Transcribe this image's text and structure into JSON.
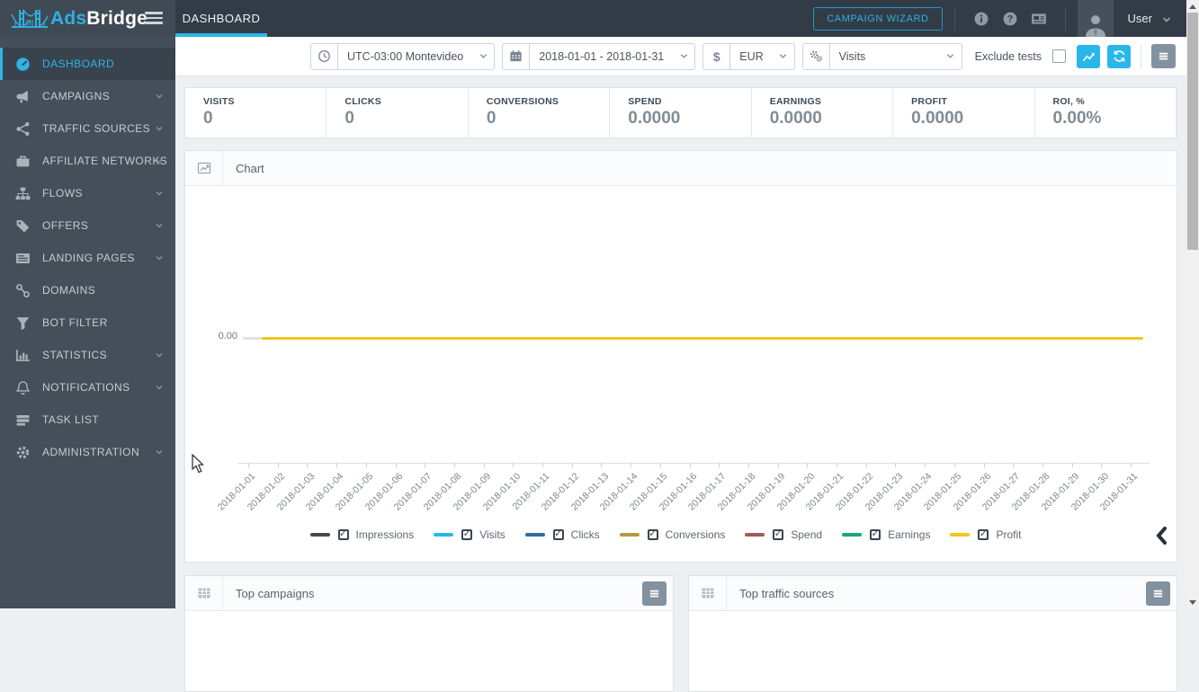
{
  "brand": {
    "name_a": "Ads",
    "name_b": "Bridge"
  },
  "topbar": {
    "active_tab": "DASHBOARD",
    "campaign_wizard_label": "CAMPAIGN WIZARD",
    "icons": [
      "info-icon",
      "help-icon",
      "news-icon"
    ],
    "user_label": "User"
  },
  "filter_bar": {
    "timezone_icon": "clock-icon",
    "timezone_value": "UTC-03:00 Montevideo",
    "date_icon": "calendar-icon",
    "date_range_value": "2018-01-01 - 2018-01-31",
    "currency_symbol": "$",
    "currency_value": "EUR",
    "metric_icon": "gears-icon",
    "metric_value": "Visits",
    "exclude_tests_label": "Exclude tests",
    "exclude_tests_checked": false,
    "buttons": [
      "trend-chart-button",
      "refresh-button",
      "menu-button"
    ]
  },
  "sidebar": {
    "items": [
      {
        "label": "DASHBOARD",
        "icon": "gauge-icon",
        "active": true,
        "expandable": false
      },
      {
        "label": "CAMPAIGNS",
        "icon": "megaphone-icon",
        "active": false,
        "expandable": true
      },
      {
        "label": "TRAFFIC SOURCES",
        "icon": "share-icon",
        "active": false,
        "expandable": true
      },
      {
        "label": "AFFILIATE NETWORKS",
        "icon": "briefcase-icon",
        "active": false,
        "expandable": true
      },
      {
        "label": "FLOWS",
        "icon": "sitemap-icon",
        "active": false,
        "expandable": true
      },
      {
        "label": "OFFERS",
        "icon": "tag-icon",
        "active": false,
        "expandable": true
      },
      {
        "label": "LANDING PAGES",
        "icon": "pages-icon",
        "active": false,
        "expandable": true
      },
      {
        "label": "DOMAINS",
        "icon": "link-icon",
        "active": false,
        "expandable": false
      },
      {
        "label": "BOT FILTER",
        "icon": "filter-icon",
        "active": false,
        "expandable": false
      },
      {
        "label": "STATISTICS",
        "icon": "bar-chart-icon",
        "active": false,
        "expandable": true
      },
      {
        "label": "NOTIFICATIONS",
        "icon": "bell-icon",
        "active": false,
        "expandable": true
      },
      {
        "label": "TASK LIST",
        "icon": "task-list-icon",
        "active": false,
        "expandable": false
      },
      {
        "label": "ADMINISTRATION",
        "icon": "gear-icon",
        "active": false,
        "expandable": true
      }
    ]
  },
  "stats": [
    {
      "label": "VISITS",
      "value": "0"
    },
    {
      "label": "CLICKS",
      "value": "0"
    },
    {
      "label": "CONVERSIONS",
      "value": "0"
    },
    {
      "label": "SPEND",
      "value": "0.0000"
    },
    {
      "label": "EARNINGS",
      "value": "0.0000"
    },
    {
      "label": "PROFIT",
      "value": "0.0000"
    },
    {
      "label": "ROI, %",
      "value": "0.00%"
    }
  ],
  "chart_panel": {
    "title": "Chart",
    "y_axis_label": "0.00"
  },
  "chart_data": {
    "type": "line",
    "title": "Chart",
    "x": [
      "2018-01-01",
      "2018-01-02",
      "2018-01-03",
      "2018-01-04",
      "2018-01-05",
      "2018-01-06",
      "2018-01-07",
      "2018-01-08",
      "2018-01-09",
      "2018-01-10",
      "2018-01-11",
      "2018-01-12",
      "2018-01-13",
      "2018-01-14",
      "2018-01-15",
      "2018-01-16",
      "2018-01-17",
      "2018-01-18",
      "2018-01-19",
      "2018-01-20",
      "2018-01-21",
      "2018-01-22",
      "2018-01-23",
      "2018-01-24",
      "2018-01-25",
      "2018-01-26",
      "2018-01-27",
      "2018-01-28",
      "2018-01-29",
      "2018-01-30",
      "2018-01-31"
    ],
    "y_ticks": [
      "0.00"
    ],
    "ylim": [
      0,
      0
    ],
    "grid": false,
    "legend_position": "bottom",
    "series": [
      {
        "name": "Impressions",
        "color": "#3e4a54",
        "checked": true,
        "values": [
          0,
          0,
          0,
          0,
          0,
          0,
          0,
          0,
          0,
          0,
          0,
          0,
          0,
          0,
          0,
          0,
          0,
          0,
          0,
          0,
          0,
          0,
          0,
          0,
          0,
          0,
          0,
          0,
          0,
          0,
          0
        ]
      },
      {
        "name": "Visits",
        "color": "#29b6e8",
        "checked": true,
        "values": [
          0,
          0,
          0,
          0,
          0,
          0,
          0,
          0,
          0,
          0,
          0,
          0,
          0,
          0,
          0,
          0,
          0,
          0,
          0,
          0,
          0,
          0,
          0,
          0,
          0,
          0,
          0,
          0,
          0,
          0,
          0
        ]
      },
      {
        "name": "Clicks",
        "color": "#2e6e9e",
        "checked": true,
        "values": [
          0,
          0,
          0,
          0,
          0,
          0,
          0,
          0,
          0,
          0,
          0,
          0,
          0,
          0,
          0,
          0,
          0,
          0,
          0,
          0,
          0,
          0,
          0,
          0,
          0,
          0,
          0,
          0,
          0,
          0,
          0
        ]
      },
      {
        "name": "Conversions",
        "color": "#b49a3a",
        "checked": true,
        "values": [
          0,
          0,
          0,
          0,
          0,
          0,
          0,
          0,
          0,
          0,
          0,
          0,
          0,
          0,
          0,
          0,
          0,
          0,
          0,
          0,
          0,
          0,
          0,
          0,
          0,
          0,
          0,
          0,
          0,
          0,
          0
        ]
      },
      {
        "name": "Spend",
        "color": "#9e5b57",
        "checked": true,
        "values": [
          0,
          0,
          0,
          0,
          0,
          0,
          0,
          0,
          0,
          0,
          0,
          0,
          0,
          0,
          0,
          0,
          0,
          0,
          0,
          0,
          0,
          0,
          0,
          0,
          0,
          0,
          0,
          0,
          0,
          0,
          0
        ]
      },
      {
        "name": "Earnings",
        "color": "#18a878",
        "checked": true,
        "values": [
          0,
          0,
          0,
          0,
          0,
          0,
          0,
          0,
          0,
          0,
          0,
          0,
          0,
          0,
          0,
          0,
          0,
          0,
          0,
          0,
          0,
          0,
          0,
          0,
          0,
          0,
          0,
          0,
          0,
          0,
          0
        ]
      },
      {
        "name": "Profit",
        "color": "#f2c51d",
        "checked": true,
        "values": [
          0,
          0,
          0,
          0,
          0,
          0,
          0,
          0,
          0,
          0,
          0,
          0,
          0,
          0,
          0,
          0,
          0,
          0,
          0,
          0,
          0,
          0,
          0,
          0,
          0,
          0,
          0,
          0,
          0,
          0,
          0
        ]
      }
    ]
  },
  "bottom_panels": [
    {
      "title": "Top campaigns",
      "icon": "table-icon"
    },
    {
      "title": "Top traffic sources",
      "icon": "table-icon"
    }
  ],
  "colors": {
    "accent": "#2eb4e6",
    "topbar_bg": "#323c46",
    "sidebar_bg": "#454f59",
    "content_bg": "#edf0f3"
  }
}
